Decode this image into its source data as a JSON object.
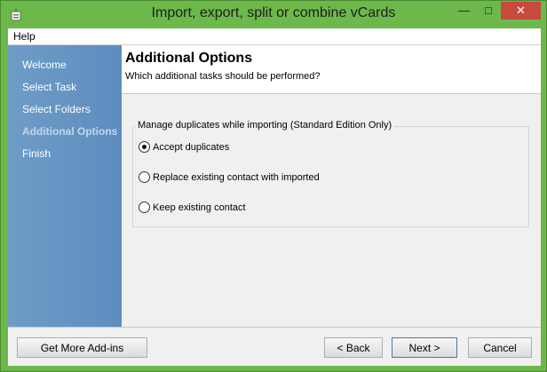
{
  "window": {
    "title": "Import, export, split or combine vCards",
    "min_glyph": "—",
    "max_glyph": "□",
    "close_glyph": "✕"
  },
  "menu": {
    "help": "Help"
  },
  "sidebar": {
    "items": [
      {
        "label": "Welcome",
        "active": false
      },
      {
        "label": "Select Task",
        "active": false
      },
      {
        "label": "Select Folders",
        "active": false
      },
      {
        "label": "Additional Options",
        "active": true
      },
      {
        "label": "Finish",
        "active": false
      }
    ]
  },
  "header": {
    "title": "Additional Options",
    "subtitle": "Which additional tasks should be performed?"
  },
  "duplicates": {
    "legend": "Manage duplicates while importing (Standard Edition Only)",
    "options": [
      {
        "label": "Accept duplicates",
        "selected": true
      },
      {
        "label": "Replace existing contact with imported",
        "selected": false
      },
      {
        "label": "Keep existing contact",
        "selected": false
      }
    ]
  },
  "buttons": {
    "addins": "Get More Add-ins",
    "back": "< Back",
    "next": "Next >",
    "cancel": "Cancel"
  },
  "colors": {
    "titlebar": "#6cb84a",
    "sidebar": "#6f9cc7",
    "close": "#c74a3f"
  }
}
